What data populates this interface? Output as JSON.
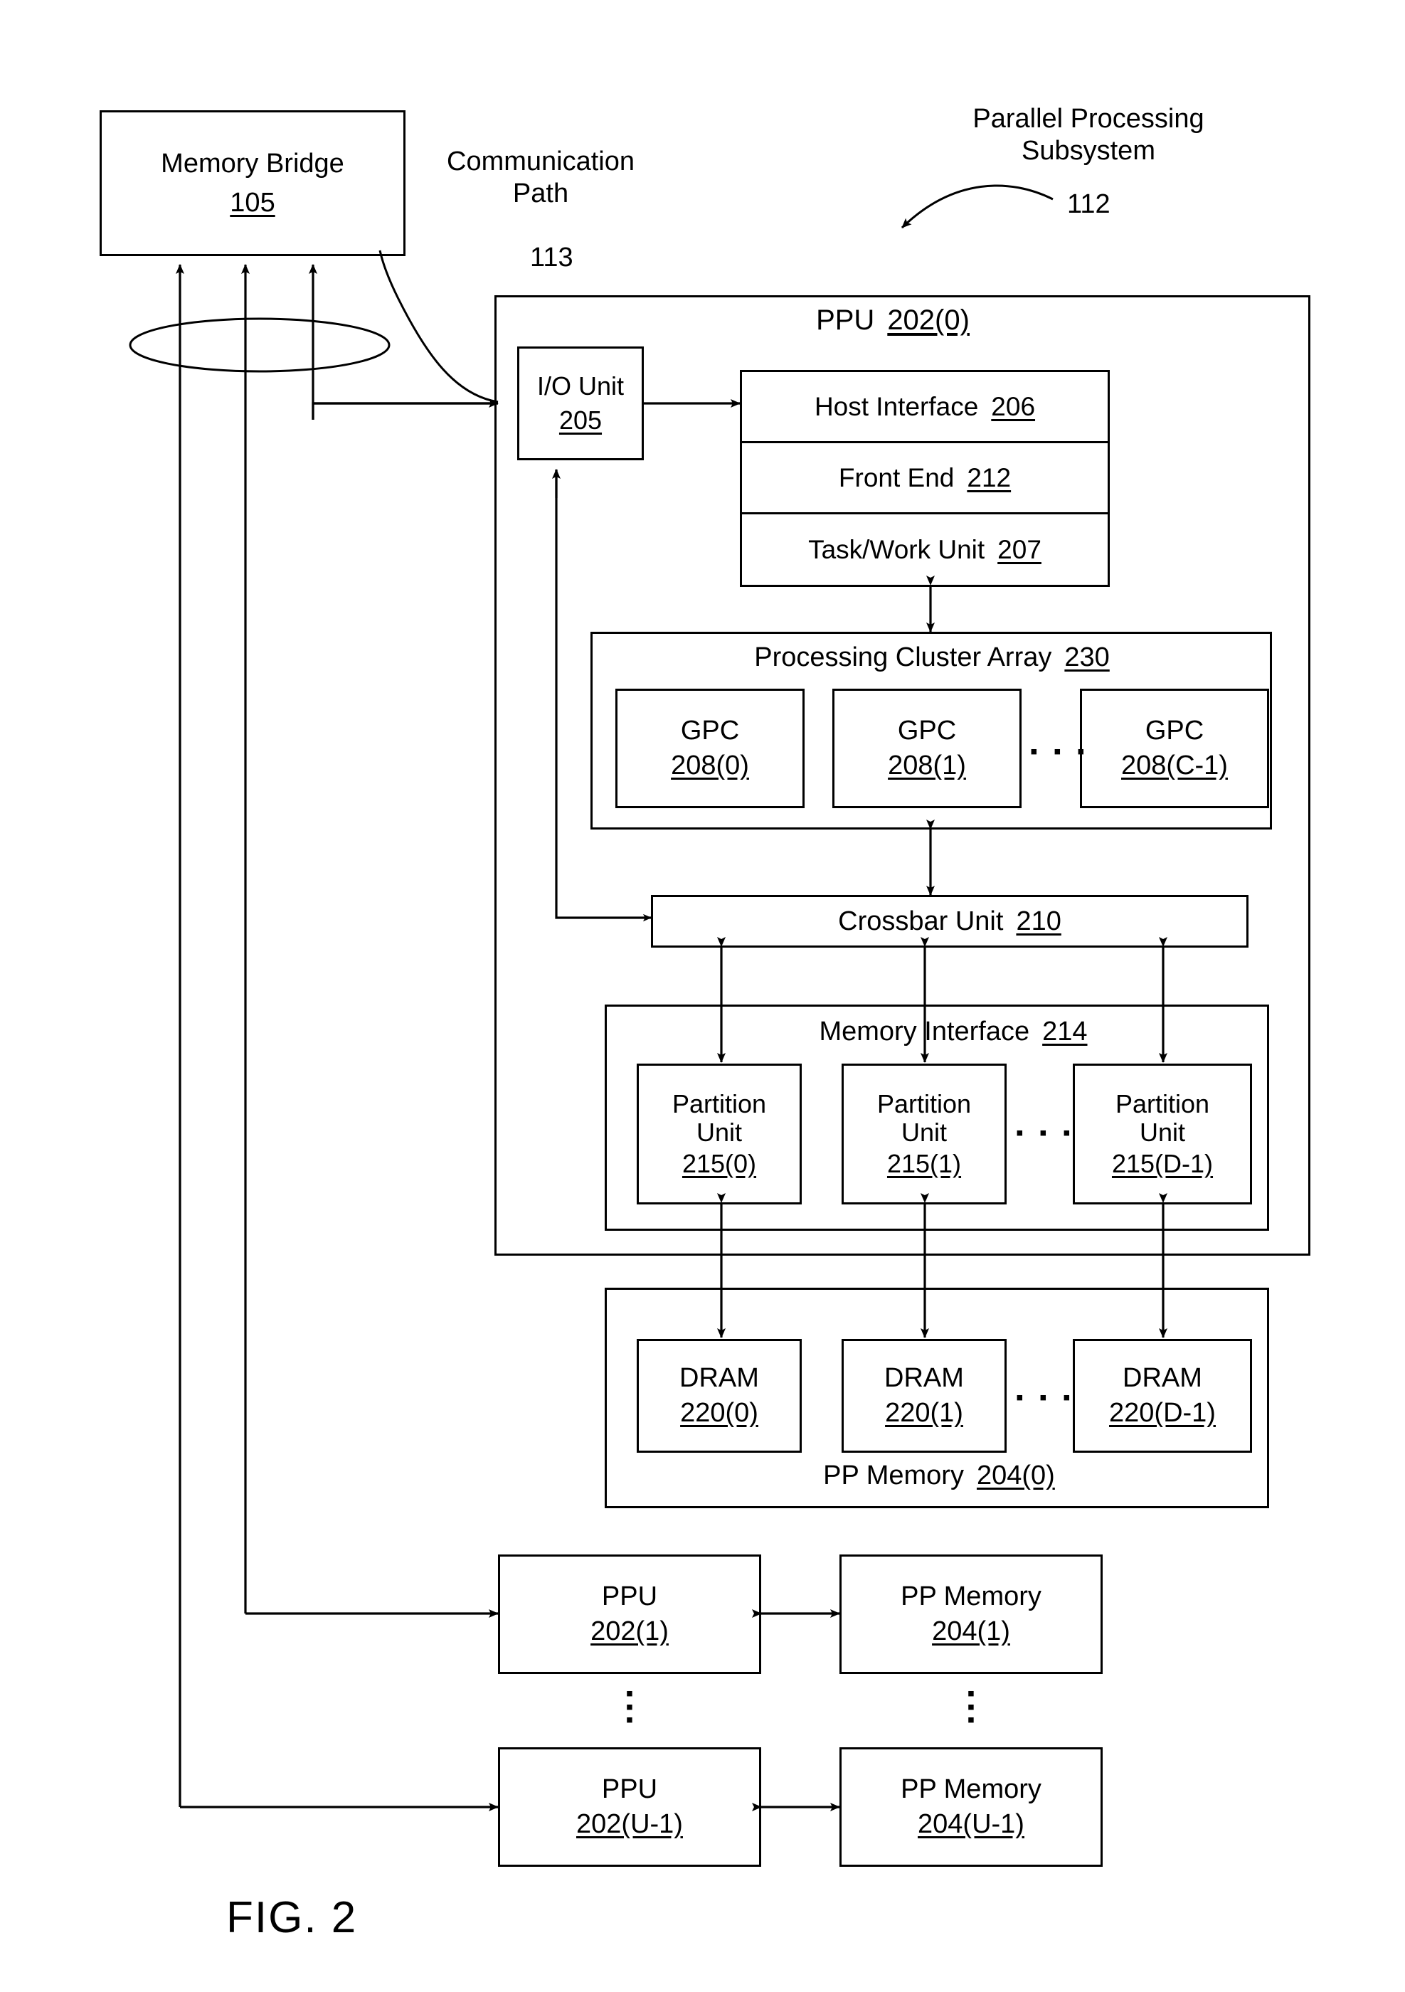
{
  "figure": {
    "caption": "FIG. 2"
  },
  "memory_bridge": {
    "title": "Memory Bridge",
    "ref": "105"
  },
  "communication_path": {
    "line1": "Communication",
    "line2": "Path",
    "ref": "113"
  },
  "subsystem": {
    "line1": "Parallel Processing",
    "line2": "Subsystem",
    "ref": "112"
  },
  "ppu0": {
    "title": "PPU",
    "ref": "202(0)"
  },
  "io_unit": {
    "title": "I/O Unit",
    "ref": "205"
  },
  "front_stack": [
    {
      "title": "Host Interface",
      "ref": "206"
    },
    {
      "title": "Front End",
      "ref": "212"
    },
    {
      "title": "Task/Work Unit",
      "ref": "207"
    }
  ],
  "processing_cluster_array": {
    "title": "Processing Cluster Array",
    "ref": "230",
    "gpcs": [
      {
        "title": "GPC",
        "ref": "208(0)"
      },
      {
        "title": "GPC",
        "ref": "208(1)"
      },
      {
        "title": "GPC",
        "ref": "208(C-1)"
      }
    ],
    "ellipsis": "▪ ▪ ▪"
  },
  "crossbar_unit": {
    "title": "Crossbar Unit",
    "ref": "210"
  },
  "memory_interface": {
    "title": "Memory Interface",
    "ref": "214",
    "partitions": [
      {
        "line1": "Partition",
        "line2": "Unit",
        "ref": "215(0)"
      },
      {
        "line1": "Partition",
        "line2": "Unit",
        "ref": "215(1)"
      },
      {
        "line1": "Partition",
        "line2": "Unit",
        "ref": "215(D-1)"
      }
    ],
    "ellipsis": "▪ ▪ ▪"
  },
  "pp_memory_0": {
    "title": "PP Memory",
    "ref": "204(0)",
    "drams": [
      {
        "title": "DRAM",
        "ref": "220(0)"
      },
      {
        "title": "DRAM",
        "ref": "220(1)"
      },
      {
        "title": "DRAM",
        "ref": "220(D-1)"
      }
    ],
    "ellipsis": "▪ ▪ ▪"
  },
  "extra_rows": [
    {
      "ppu": {
        "title": "PPU",
        "ref": "202(1)"
      },
      "mem": {
        "title": "PP Memory",
        "ref": "204(1)"
      }
    },
    {
      "ppu": {
        "title": "PPU",
        "ref": "202(U-1)"
      },
      "mem": {
        "title": "PP Memory",
        "ref": "204(U-1)"
      }
    }
  ],
  "vertical_ellipsis": "▪\n▪\n▪",
  "colors": {
    "stroke": "#000000",
    "background": "#ffffff"
  }
}
